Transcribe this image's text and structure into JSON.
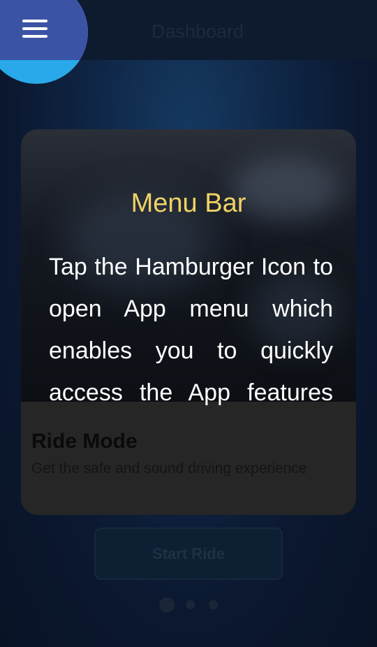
{
  "header": {
    "title": "Dashboard",
    "menu_icon": "hamburger-menu-icon"
  },
  "tooltip": {
    "title": "Menu Bar",
    "body": "Tap the Hamburger Icon to open App menu which enables you to quickly access the App features"
  },
  "card": {
    "title": "Ride Mode",
    "subtitle": "Get the safe and sound driving experience"
  },
  "actions": {
    "start_ride_label": "Start Ride"
  },
  "pager": {
    "total": 3,
    "active": 1
  },
  "colors": {
    "accent_blue": "#29a9e9",
    "menu_button": "#3b53a5",
    "tooltip_title": "#f0d264",
    "tooltip_text": "#ffffff"
  }
}
